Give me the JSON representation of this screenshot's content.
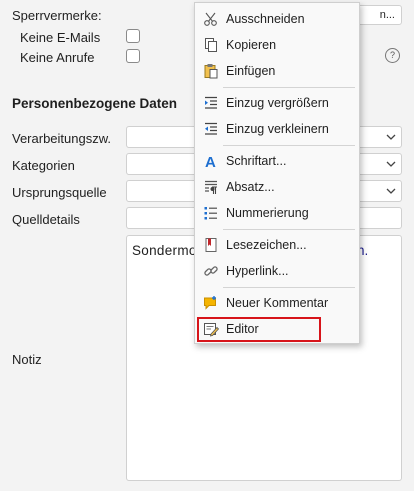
{
  "form": {
    "sperr_label": "Sperrvermerke:",
    "top_button_suffix": "n...",
    "keine_emails_label": "Keine E-Mails",
    "keine_anrufe_label": "Keine Anrufe",
    "section_title": "Personenbezogene Daten",
    "verarbeitungszweck_label": "Verarbeitungszw.",
    "kategorien_label": "Kategorien",
    "ursprungsquelle_label": "Ursprungsquelle",
    "quelldetails_label": "Quelldetails",
    "notiz_label": "Notiz",
    "notiz_text_visible": "Sondermo",
    "notiz_text_tail": "n.",
    "help_glyph": "?"
  },
  "context_menu": {
    "items": [
      {
        "label": "Ausschneiden",
        "icon": "scissors-icon"
      },
      {
        "label": "Kopieren",
        "icon": "copy-icon"
      },
      {
        "label": "Einfügen",
        "icon": "paste-icon"
      },
      {
        "label": "Einzug vergrößern",
        "icon": "indent-increase-icon"
      },
      {
        "label": "Einzug verkleinern",
        "icon": "indent-decrease-icon"
      },
      {
        "label": "Schriftart...",
        "icon": "font-icon"
      },
      {
        "label": "Absatz...",
        "icon": "paragraph-icon"
      },
      {
        "label": "Nummerierung",
        "icon": "numbered-list-icon"
      },
      {
        "label": "Lesezeichen...",
        "icon": "bookmark-icon"
      },
      {
        "label": "Hyperlink...",
        "icon": "link-icon"
      },
      {
        "label": "Neuer Kommentar",
        "icon": "comment-icon"
      },
      {
        "label": "Editor",
        "icon": "editor-icon"
      }
    ],
    "highlighted_item": "Editor",
    "highlight_color": "#d7141a"
  }
}
